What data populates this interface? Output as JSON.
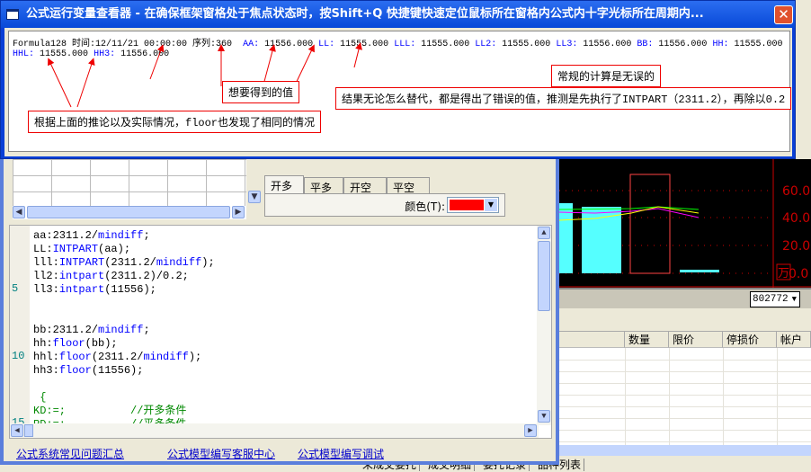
{
  "window": {
    "title": "公式运行变量查看器 - 在确保框架窗格处于焦点状态时，按Shift+Q 快捷键快速定位鼠标所在窗格内公式内十字光标所在周期内...",
    "close": "✕"
  },
  "vars": {
    "header": "Formula128 时间:12/11/21 00:00:00 序列:360",
    "items": [
      {
        "n": "AA:",
        "v": "11556.000"
      },
      {
        "n": "LL:",
        "v": "11555.000"
      },
      {
        "n": "LLL:",
        "v": "11555.000"
      },
      {
        "n": "LL2:",
        "v": "11555.000"
      },
      {
        "n": "LL3:",
        "v": "11556.000"
      },
      {
        "n": "BB:",
        "v": "11556.000"
      },
      {
        "n": "HH:",
        "v": "11555.000"
      },
      {
        "n": "HHL:",
        "v": "11555.000"
      },
      {
        "n": "HH3:",
        "v": "11556.000"
      }
    ]
  },
  "notes": {
    "n1": "想要得到的值",
    "n2": "结果无论怎么替代，都是得出了错误的值，推测是先执行了INTPART（2311.2），再除以0.2",
    "n3": "常规的计算是无误的",
    "n4": "根据上面的推论以及实际情况，floor也发现了相同的情况"
  },
  "tabs": [
    "开多",
    "平多",
    "开空",
    "平空"
  ],
  "color_label": "颜色(T):",
  "color_value": "#ff0000",
  "code": {
    "line_numbers": [
      "5",
      "10",
      "15"
    ]
  },
  "links": [
    "公式系统常见问题汇总",
    "公式模型编写客服中心",
    "公式模型编写调试"
  ],
  "chart": {
    "y_ticks": [
      "60.0",
      "40.0",
      "20.0",
      "0.0"
    ],
    "unit": "万"
  },
  "account_combo": "802772",
  "table_headers": [
    "数量",
    "限价",
    "停损价",
    "帐户"
  ],
  "bottom_tabs": [
    "未成交委托",
    "成交明细",
    "委托记录",
    "品种列表"
  ]
}
